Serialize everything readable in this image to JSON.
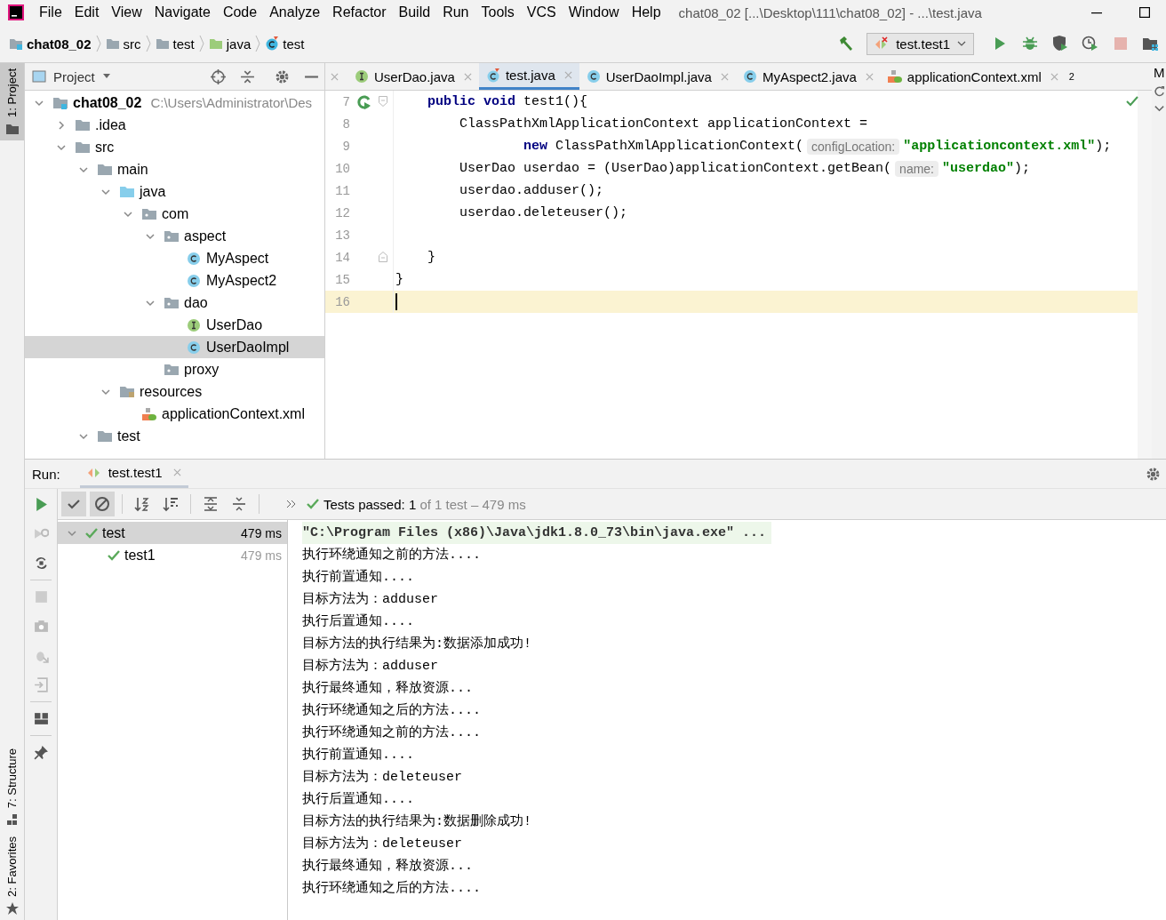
{
  "window": {
    "title": "chat08_02 [...\\Desktop\\111\\chat08_02] - ...\\test.java"
  },
  "menu": [
    "File",
    "Edit",
    "View",
    "Navigate",
    "Code",
    "Analyze",
    "Refactor",
    "Build",
    "Run",
    "Tools",
    "VCS",
    "Window",
    "Help"
  ],
  "breadcrumbs": [
    {
      "label": "chat08_02",
      "kind": "module"
    },
    {
      "label": "src",
      "kind": "folder"
    },
    {
      "label": "test",
      "kind": "folder"
    },
    {
      "label": "java",
      "kind": "test-source"
    },
    {
      "label": "test",
      "kind": "class"
    }
  ],
  "run_config": {
    "label": "test.test1"
  },
  "toolbar": [
    {
      "kind": "run",
      "disabled": false
    },
    {
      "kind": "debug",
      "disabled": false
    },
    {
      "kind": "coverage",
      "disabled": false
    },
    {
      "kind": "profile",
      "disabled": false
    },
    {
      "kind": "stop",
      "disabled": true
    },
    {
      "kind": "structure",
      "disabled": false
    }
  ],
  "left_stripe_top": [
    {
      "label": "1: Project",
      "kind": "project",
      "selected": true
    }
  ],
  "left_stripe_bottom": [
    {
      "label": "7: Structure",
      "kind": "structure",
      "selected": false
    },
    {
      "label": "2: Favorites",
      "kind": "favorites",
      "selected": false
    }
  ],
  "project_panel": {
    "title": "Project"
  },
  "tree": [
    {
      "label": "chat08_02",
      "kind": "module",
      "note": "C:\\Users\\Administrator\\Des",
      "expanded": true,
      "selected": false,
      "children": [
        {
          "label": ".idea",
          "kind": "folder",
          "expanded": false,
          "selected": false
        },
        {
          "label": "src",
          "kind": "folder",
          "expanded": true,
          "selected": false,
          "children": [
            {
              "label": "main",
              "kind": "folder",
              "expanded": true,
              "selected": false,
              "children": [
                {
                  "label": "java",
                  "kind": "source",
                  "expanded": true,
                  "selected": false,
                  "children": [
                    {
                      "label": "com",
                      "kind": "package",
                      "expanded": true,
                      "selected": false,
                      "children": [
                        {
                          "label": "aspect",
                          "kind": "package",
                          "expanded": true,
                          "selected": false,
                          "children": [
                            {
                              "label": "MyAspect",
                              "kind": "class",
                              "selected": false
                            },
                            {
                              "label": "MyAspect2",
                              "kind": "class",
                              "selected": false
                            }
                          ]
                        },
                        {
                          "label": "dao",
                          "kind": "package",
                          "expanded": true,
                          "selected": false,
                          "children": [
                            {
                              "label": "UserDao",
                              "kind": "interface",
                              "selected": false
                            },
                            {
                              "label": "UserDaoImpl",
                              "kind": "class",
                              "selected": true
                            }
                          ]
                        },
                        {
                          "label": "proxy",
                          "kind": "package",
                          "selected": false
                        }
                      ]
                    }
                  ]
                },
                {
                  "label": "resources",
                  "kind": "resources",
                  "expanded": true,
                  "selected": false,
                  "children": [
                    {
                      "label": "applicationContext.xml",
                      "kind": "xml",
                      "selected": false
                    }
                  ]
                }
              ]
            },
            {
              "label": "test",
              "kind": "folder",
              "expanded": true,
              "selected": false
            }
          ]
        }
      ]
    }
  ],
  "editor_tabs": [
    {
      "label": "UserDao.java",
      "kind": "interface",
      "selected": false
    },
    {
      "label": "test.java",
      "kind": "test",
      "selected": true
    },
    {
      "label": "UserDaoImpl.java",
      "kind": "class",
      "selected": false
    },
    {
      "label": "MyAspect2.java",
      "kind": "class",
      "selected": false
    },
    {
      "label": "applicationContext.xml",
      "kind": "xml",
      "selected": false
    }
  ],
  "tab_overflow": "2",
  "right_stripe_label": "M",
  "code": [
    {
      "number": "7",
      "run_mark": true,
      "fold_start": true,
      "current": false,
      "segments": [
        {
          "kind": "keyword",
          "text": "    public void"
        },
        {
          "kind": "text",
          "text": " test1(){"
        }
      ]
    },
    {
      "number": "8",
      "current": false,
      "segments": [
        {
          "kind": "text",
          "text": "        ClassPathXmlApplicationContext applicationContext ="
        }
      ]
    },
    {
      "number": "9",
      "current": false,
      "segments": [
        {
          "kind": "keyword",
          "text": "                new"
        },
        {
          "kind": "text",
          "text": " ClassPathXmlApplicationContext("
        },
        {
          "kind": "hint",
          "text": "configLocation:"
        },
        {
          "kind": "string",
          "text": "\"applicationcontext.xml\""
        },
        {
          "kind": "text",
          "text": ");"
        }
      ]
    },
    {
      "number": "10",
      "current": false,
      "segments": [
        {
          "kind": "text",
          "text": "        UserDao userdao = (UserDao)applicationContext.getBean("
        },
        {
          "kind": "hint",
          "text": "name:"
        },
        {
          "kind": "string",
          "text": "\"userdao\""
        },
        {
          "kind": "text",
          "text": ");"
        }
      ]
    },
    {
      "number": "11",
      "current": false,
      "segments": [
        {
          "kind": "text",
          "text": "        userdao.adduser();"
        }
      ]
    },
    {
      "number": "12",
      "current": false,
      "segments": [
        {
          "kind": "text",
          "text": "        userdao.deleteuser();"
        }
      ]
    },
    {
      "number": "13",
      "current": false
    },
    {
      "number": "14",
      "fold_end": true,
      "current": false,
      "segments": [
        {
          "kind": "text",
          "text": "    }"
        }
      ]
    },
    {
      "number": "15",
      "current": false,
      "segments": [
        {
          "kind": "text",
          "text": "}"
        }
      ]
    },
    {
      "number": "16",
      "current": true
    }
  ],
  "run_panel": {
    "label": "Run:",
    "tab": "test.test1",
    "status": "Tests passed: 1",
    "status_detail": " of 1 test – 479 ms"
  },
  "test_tree": [
    {
      "label": "test",
      "time": "479 ms",
      "passed": true,
      "expanded": true,
      "selected": true,
      "children": [
        {
          "label": "test1",
          "time": "479 ms",
          "passed": true,
          "selected": false
        }
      ]
    }
  ],
  "console": [
    {
      "kind": "command",
      "text": "\"C:\\Program Files (x86)\\Java\\jdk1.8.0_73\\bin\\java.exe\" ..."
    },
    {
      "kind": "output",
      "text": "执行环绕通知之前的方法...."
    },
    {
      "kind": "output",
      "text": "执行前置通知...."
    },
    {
      "kind": "output",
      "text": "目标方法为：adduser"
    },
    {
      "kind": "output",
      "text": "执行后置通知...."
    },
    {
      "kind": "output",
      "text": "目标方法的执行结果为:数据添加成功!"
    },
    {
      "kind": "output",
      "text": "目标方法为：adduser"
    },
    {
      "kind": "output",
      "text": "执行最终通知，释放资源..."
    },
    {
      "kind": "output",
      "text": "执行环绕通知之后的方法...."
    },
    {
      "kind": "output",
      "text": "执行环绕通知之前的方法...."
    },
    {
      "kind": "output",
      "text": "执行前置通知...."
    },
    {
      "kind": "output",
      "text": "目标方法为：deleteuser"
    },
    {
      "kind": "output",
      "text": "执行后置通知...."
    },
    {
      "kind": "output",
      "text": "目标方法的执行结果为:数据删除成功!"
    },
    {
      "kind": "output",
      "text": "目标方法为：deleteuser"
    },
    {
      "kind": "output",
      "text": "执行最终通知，释放资源..."
    },
    {
      "kind": "output",
      "text": "执行环绕通知之后的方法...."
    }
  ]
}
